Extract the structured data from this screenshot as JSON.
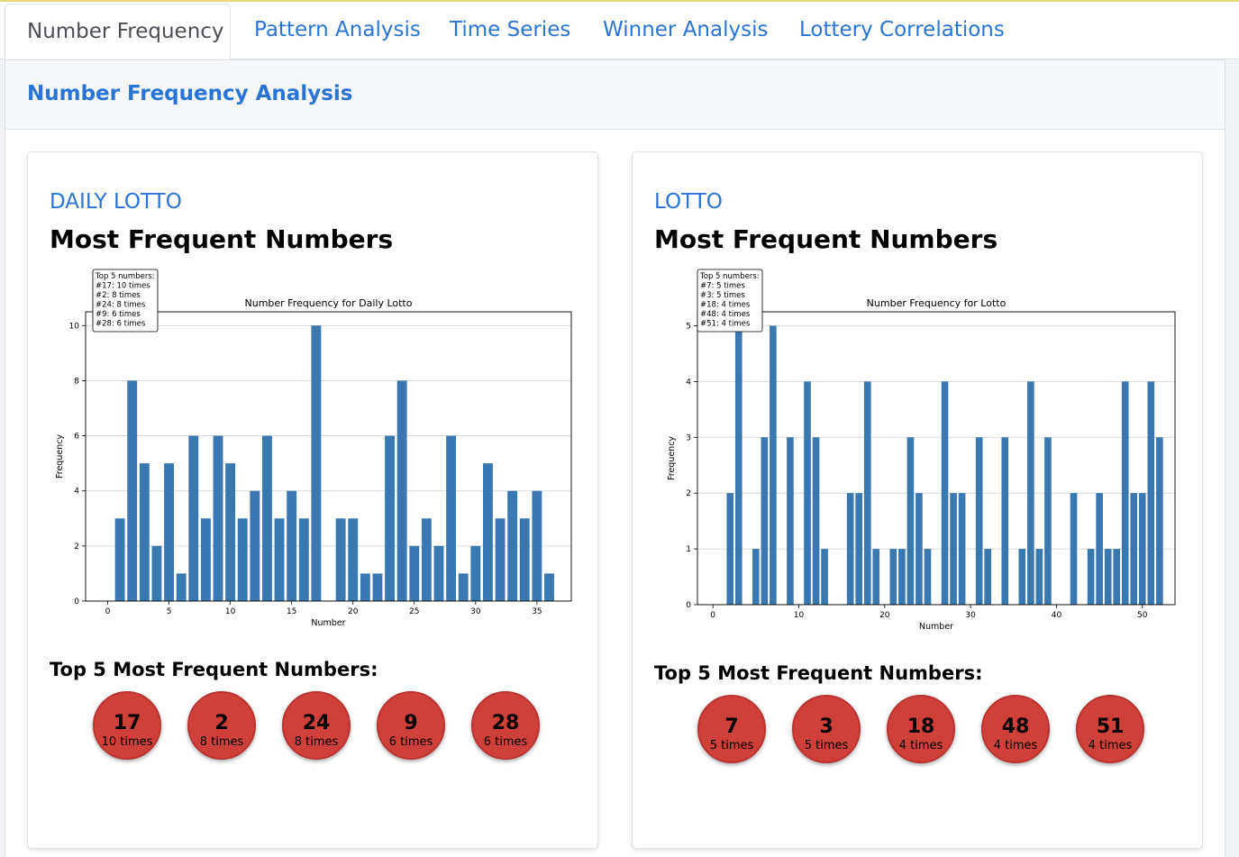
{
  "tabs": [
    {
      "label": "Number Frequency",
      "active": true
    },
    {
      "label": "Pattern Analysis",
      "active": false
    },
    {
      "label": "Time Series",
      "active": false
    },
    {
      "label": "Winner Analysis",
      "active": false
    },
    {
      "label": "Lottery Correlations",
      "active": false
    }
  ],
  "panel": {
    "title": "Number Frequency Analysis"
  },
  "cards": [
    {
      "lottery_name": "DAILY LOTTO",
      "heading": "Most Frequent Numbers",
      "top_title": "Top 5 Most Frequent Numbers:",
      "top": [
        {
          "number": "17",
          "count": "10 times"
        },
        {
          "number": "2",
          "count": "8 times"
        },
        {
          "number": "24",
          "count": "8 times"
        },
        {
          "number": "9",
          "count": "6 times"
        },
        {
          "number": "28",
          "count": "6 times"
        }
      ]
    },
    {
      "lottery_name": "LOTTO",
      "heading": "Most Frequent Numbers",
      "top_title": "Top 5 Most Frequent Numbers:",
      "top": [
        {
          "number": "7",
          "count": "5 times"
        },
        {
          "number": "3",
          "count": "5 times"
        },
        {
          "number": "18",
          "count": "4 times"
        },
        {
          "number": "48",
          "count": "4 times"
        },
        {
          "number": "51",
          "count": "4 times"
        }
      ]
    }
  ],
  "chart_data": [
    {
      "type": "bar",
      "title": "Number Frequency for Daily Lotto",
      "xlabel": "Number",
      "ylabel": "Frequency",
      "xlim": [
        -1.8,
        37.8
      ],
      "ylim": [
        0,
        10.5
      ],
      "xticks": [
        0,
        5,
        10,
        15,
        20,
        25,
        30,
        35
      ],
      "yticks": [
        0,
        2,
        4,
        6,
        8,
        10
      ],
      "grid": "horizontal",
      "bar_color": "#3a78b2",
      "x": [
        1,
        2,
        3,
        4,
        5,
        6,
        7,
        8,
        9,
        10,
        11,
        12,
        13,
        14,
        15,
        16,
        17,
        19,
        20,
        21,
        22,
        23,
        24,
        25,
        26,
        27,
        28,
        29,
        30,
        31,
        32,
        33,
        34,
        35,
        36
      ],
      "values": [
        3,
        8,
        5,
        2,
        5,
        1,
        6,
        3,
        6,
        5,
        3,
        4,
        6,
        3,
        4,
        3,
        10,
        3,
        3,
        1,
        1,
        6,
        8,
        2,
        3,
        2,
        6,
        1,
        2,
        5,
        3,
        4,
        3,
        4,
        1
      ],
      "annotation": {
        "placement": "top-left",
        "lines": [
          "Top 5 numbers:",
          "#17: 10 times",
          "#2: 8 times",
          "#24: 8 times",
          "#9: 6 times",
          "#28: 6 times"
        ]
      }
    },
    {
      "type": "bar",
      "title": "Number Frequency for Lotto",
      "xlabel": "Number",
      "ylabel": "Frequency",
      "xlim": [
        -1.8,
        53.8
      ],
      "ylim": [
        0,
        5.25
      ],
      "xticks": [
        0,
        10,
        20,
        30,
        40,
        50
      ],
      "yticks": [
        0,
        1,
        2,
        3,
        4,
        5
      ],
      "grid": "horizontal",
      "bar_color": "#3a78b2",
      "x": [
        2,
        3,
        5,
        6,
        7,
        9,
        11,
        12,
        13,
        16,
        17,
        18,
        19,
        21,
        22,
        23,
        24,
        25,
        27,
        28,
        29,
        31,
        32,
        34,
        36,
        37,
        38,
        39,
        42,
        44,
        45,
        46,
        47,
        48,
        49,
        50,
        51,
        52
      ],
      "values": [
        2,
        5,
        1,
        3,
        5,
        3,
        4,
        3,
        1,
        2,
        2,
        4,
        1,
        1,
        1,
        3,
        2,
        1,
        4,
        2,
        2,
        3,
        1,
        3,
        1,
        4,
        1,
        3,
        2,
        1,
        2,
        1,
        1,
        4,
        2,
        2,
        4,
        3
      ],
      "annotation": {
        "placement": "top-left",
        "lines": [
          "Top 5 numbers:",
          "#7: 5 times",
          "#3: 5 times",
          "#18: 4 times",
          "#48: 4 times",
          "#51: 4 times"
        ]
      }
    }
  ]
}
